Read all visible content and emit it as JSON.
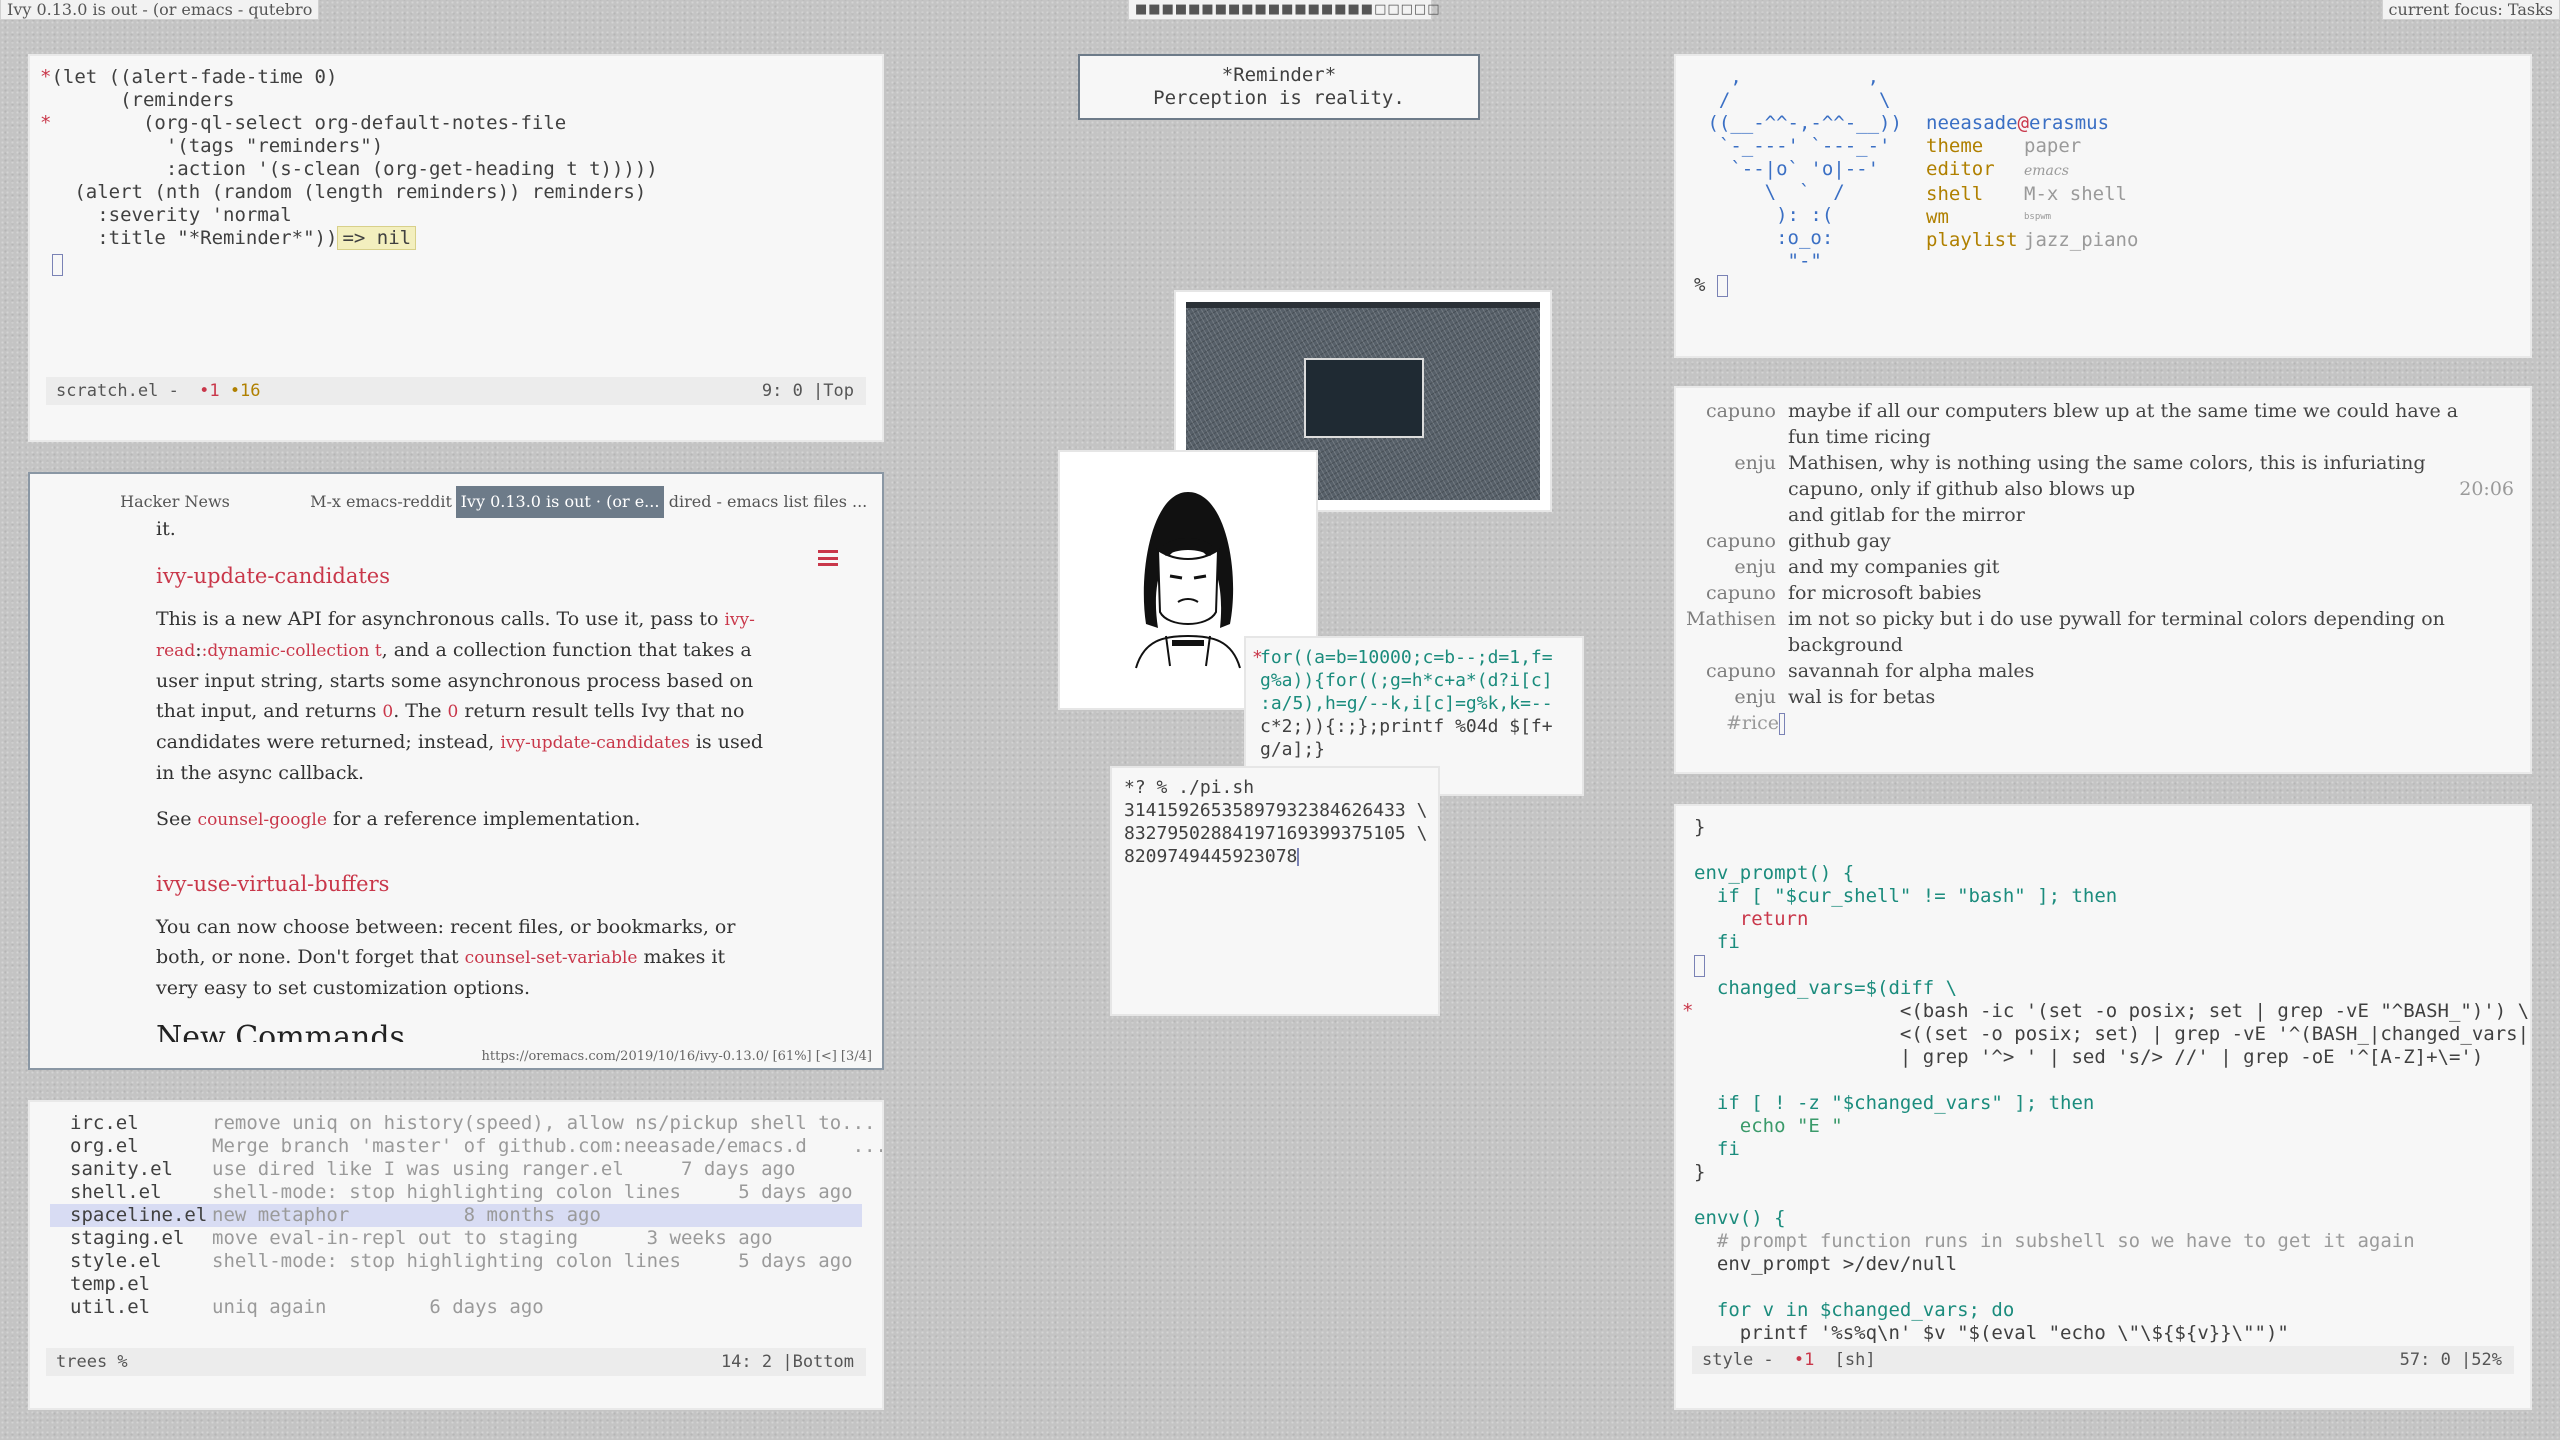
{
  "bars": {
    "left_title": "Ivy 0.13.0 is out - (or emacs - qutebro",
    "workspaces": "■■■■■■■■■■■■■■■■■■□□□□□",
    "right_focus": "current focus: Tasks"
  },
  "scratch": {
    "lines": [
      "(let ((alert-fade-time 0)",
      "      (reminders",
      "        (org-ql-select org-default-notes-file",
      "          '(tags \"reminders\")",
      "          :action '(s-clean (org-get-heading t t)))))",
      "  (alert (nth (random (length reminders)) reminders)",
      "    :severity 'normal",
      "    :title \"*Reminder*\"))"
    ],
    "result": "=> nil",
    "modeline": {
      "name": "scratch.el -",
      "errors": "•1",
      "warnings": "•16",
      "pos": "9: 0 |Top"
    }
  },
  "reminder": {
    "title": "*Reminder*",
    "body": "Perception is reality."
  },
  "browser": {
    "tabs": [
      "Hacker News",
      "M-x emacs-reddit",
      "Ivy 0.13.0 is out · (or e...",
      "dired - emacs list files ..."
    ],
    "intro": "it.",
    "section1_title": "ivy-update-candidates",
    "s1": {
      "t1": "This is a new API for asynchronous calls. To use it, pass to ",
      "l1": "ivy-read",
      "t2": ":",
      "l2": ":dynamic-collection t",
      "t3": ", and a collection function that takes a user input string, starts some asynchronous process based on that input, and returns ",
      "l3": "0",
      "t4": ". The ",
      "l4": "0",
      "t5": " return result tells Ivy that no candidates were returned; instead, ",
      "l5": "ivy-update-candidates",
      "t6": " is used in the async callback."
    },
    "see_text": "See ",
    "see_link": "counsel-google",
    "see_rest": " for a reference implementation.",
    "section2_title": "ivy-use-virtual-buffers",
    "s2": {
      "t1": "You can now choose between: recent files, or bookmarks, or both, or none. Don't forget that ",
      "l1": "counsel-set-variable",
      "t2": " makes it very easy to set customization options."
    },
    "section3_partial": "New Commands",
    "status": "https://oremacs.com/2019/10/16/ivy-0.13.0/ [61%] [<] [3/4]"
  },
  "git": {
    "rows": [
      {
        "file": "irc.el",
        "msg": "remove uniq on history(speed), allow ns/pickup shell to..."
      },
      {
        "file": "org.el",
        "msg": "Merge branch 'master' of github.com:neeasade/emacs.d    ..."
      },
      {
        "file": "sanity.el",
        "msg": "use dired like I was using ranger.el     7 days ago"
      },
      {
        "file": "shell.el",
        "msg": "shell-mode: stop highlighting colon lines     5 days ago"
      },
      {
        "file": "spaceline.el",
        "msg": "new metaphor          8 months ago"
      },
      {
        "file": "staging.el",
        "msg": "move eval-in-repl out to staging      3 weeks ago"
      },
      {
        "file": "style.el",
        "msg": "shell-mode: stop highlighting colon lines     5 days ago"
      },
      {
        "file": "temp.el",
        "msg": ""
      },
      {
        "file": "util.el",
        "msg": "uniq again         6 days ago"
      }
    ],
    "modeline": {
      "name": "trees %",
      "pos": "14: 2 |Bottom"
    }
  },
  "neofetch": {
    "ascii": [
      "   ,           ,",
      "  /             \\",
      " ((__-^^-,-^^-__))",
      "  `-_---' `---_-'",
      "   `--|o` 'o|--'",
      "      \\  `  /",
      "       ): :(",
      "       :o_o:",
      "        \"-\""
    ],
    "user": "neeasade",
    "at": "@",
    "host": "erasmus",
    "rows": [
      {
        "key": "theme",
        "val": "paper"
      },
      {
        "key": "editor",
        "val": "emacs"
      },
      {
        "key": "shell",
        "val": "M-x shell"
      },
      {
        "key": "wm",
        "val": "bspwm"
      },
      {
        "key": "playlist",
        "val": "jazz_piano"
      }
    ],
    "prompt": "%"
  },
  "chat": {
    "lines": [
      {
        "nick": "capuno",
        "msg": "maybe if all our computers blew up at the same time we could have a"
      },
      {
        "nick": "",
        "msg": "fun time ricing"
      },
      {
        "nick": "enju",
        "msg": "Mathisen, why is nothing using the same colors, this is infuriating"
      },
      {
        "nick": "",
        "msg": "capuno, only if github also blows up"
      },
      {
        "nick": "",
        "msg": "and gitlab for the mirror"
      },
      {
        "nick": "capuno",
        "msg": "github gay"
      },
      {
        "nick": "enju",
        "msg": "and my companies git"
      },
      {
        "nick": "capuno",
        "msg": "for microsoft babies"
      },
      {
        "nick": "Mathisen",
        "msg": "im not so picky but i do use pywall for terminal colors depending on"
      },
      {
        "nick": "",
        "msg": "background"
      },
      {
        "nick": "capuno",
        "msg": "savannah for alpha males"
      },
      {
        "nick": "enju",
        "msg": "wal is for betas"
      }
    ],
    "time": "20:06",
    "input": "#rice"
  },
  "term_pi_code": {
    "lines": [
      "for((a=b=10000;c=b--;d=1,f=",
      "g%a)){for((;g=h*c+a*(d?i[c]",
      ":a/5),h=g/--k,i[c]=g%k,k=--",
      "c*2;)){:;};printf %04d $[f+",
      "g/a];}"
    ]
  },
  "term_pi_run": {
    "prompt": "*? % ./pi.sh",
    "out": [
      "31415926535897932384626433 \\",
      "83279502884197169399375105 \\",
      "8209749445923078"
    ]
  },
  "shell_editor": {
    "lines": [
      "}",
      "",
      "env_prompt() {",
      "  if [ \"$cur_shell\" != \"bash\" ]; then",
      "    return",
      "  fi",
      "",
      "  changed_vars=$(diff \\",
      "                  <(bash -ic '(set -o posix; set | grep -vE \"^BASH_\")') \\",
      "                  <((set -o posix; set) | grep -vE '^(BASH_|changed_vars|",
      "                  | grep '^> ' | sed 's/> //' | grep -oE '^[A-Z]+\\=')",
      "",
      "  if [ ! -z \"$changed_vars\" ]; then",
      "    echo \"E \"",
      "  fi",
      "}",
      "",
      "envv() {",
      "  # prompt function runs in subshell so we have to get it again",
      "  env_prompt >/dev/null",
      "",
      "  for v in $changed_vars; do",
      "    printf '%s%q\\n' $v \"$(eval \"echo \\\"\\${${v}}\\\"\")\""
    ],
    "modeline": {
      "name": "style -",
      "errors": "•1",
      "mode": "[sh]",
      "pos": "57: 0 |52%"
    }
  },
  "colors": {
    "accent_red": "#c9374a",
    "string_green": "#3a9a6a",
    "keyword_teal": "#1b8c7d",
    "yellow": "#b08000",
    "blue": "#3a6fc4",
    "tab_active": "#6d7b89"
  }
}
